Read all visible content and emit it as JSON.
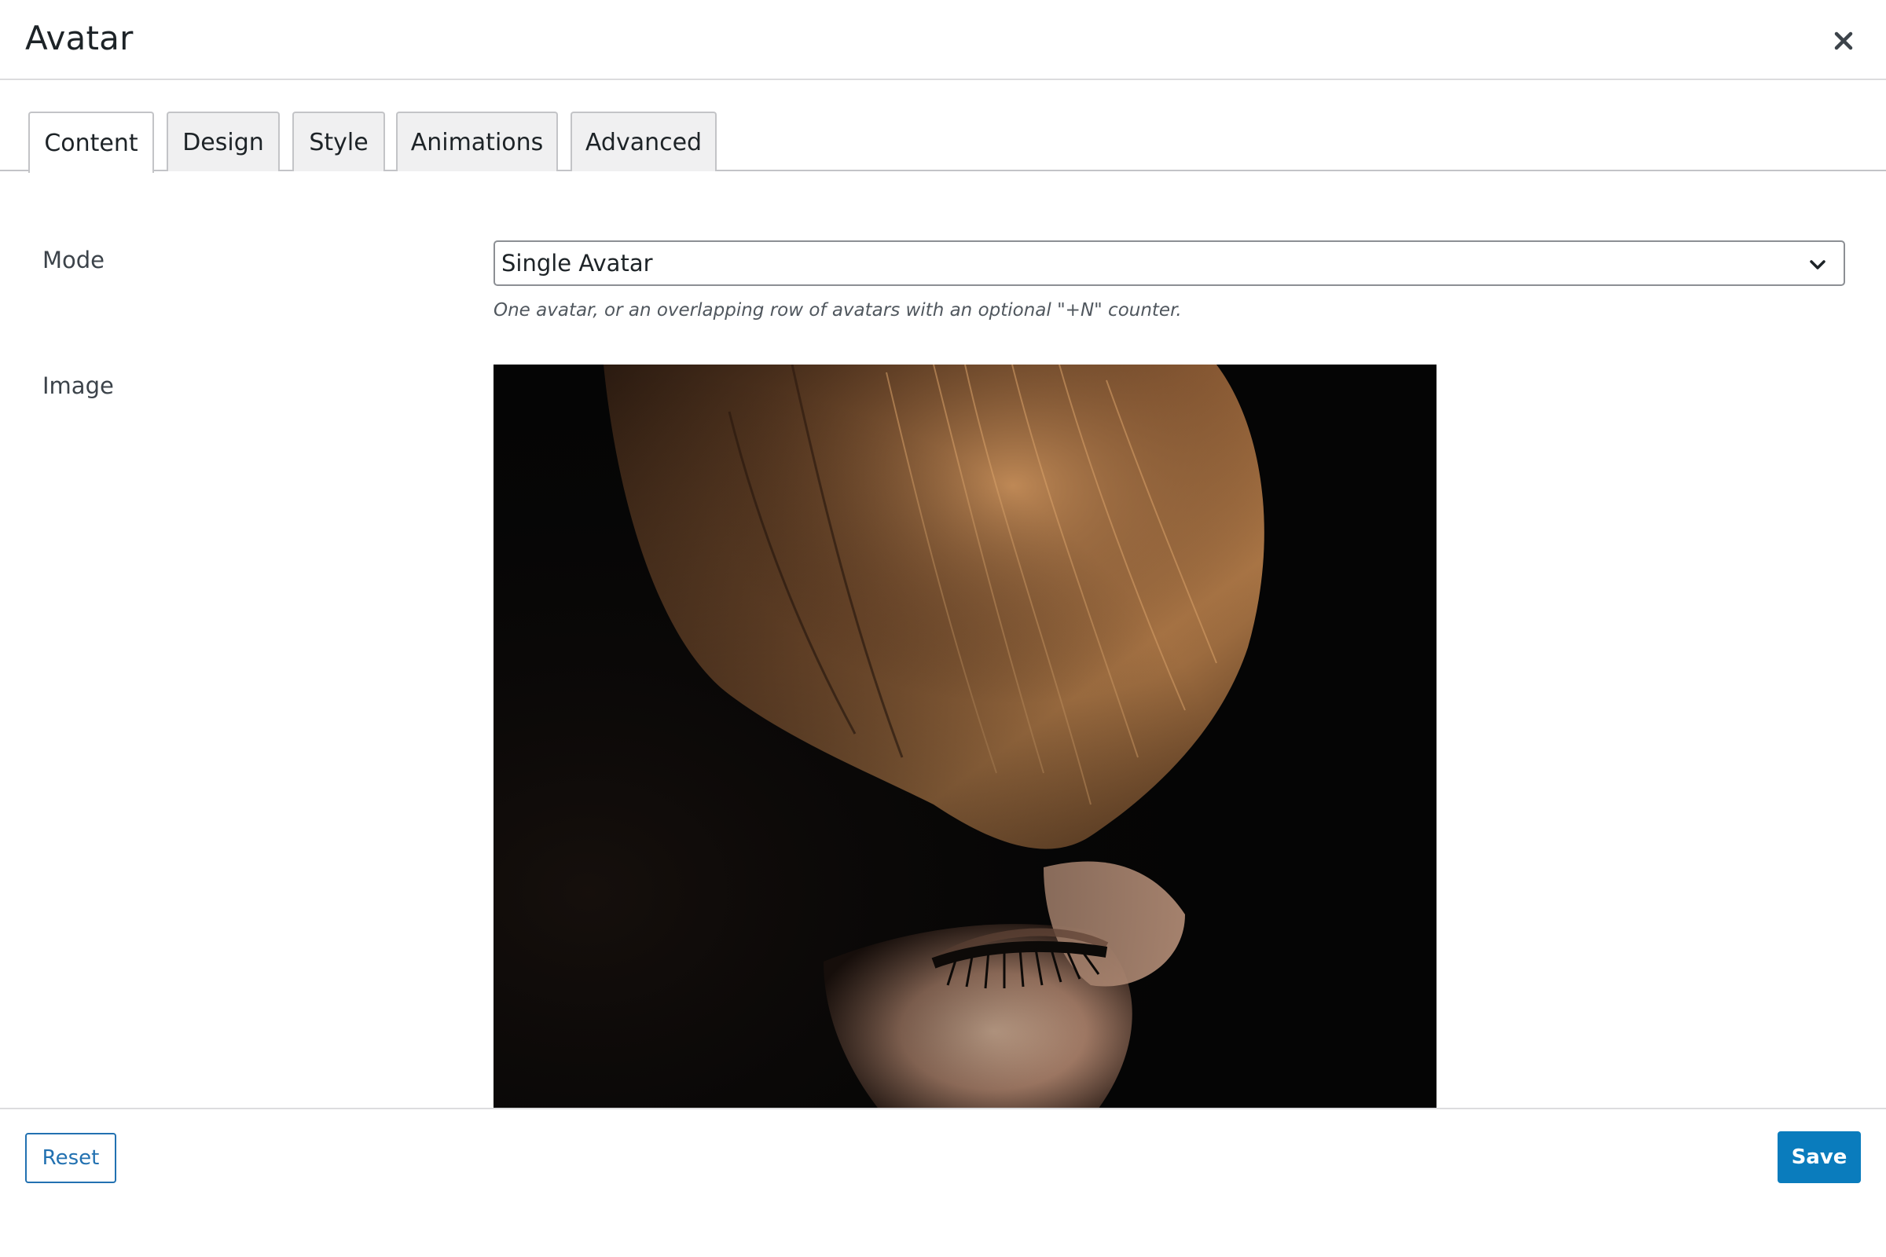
{
  "modal": {
    "title": "Avatar"
  },
  "tabs": [
    {
      "label": "Content",
      "active": true
    },
    {
      "label": "Design",
      "active": false
    },
    {
      "label": "Style",
      "active": false
    },
    {
      "label": "Animations",
      "active": false
    },
    {
      "label": "Advanced",
      "active": false
    }
  ],
  "fields": {
    "mode": {
      "label": "Mode",
      "value": "Single Avatar",
      "description": "One avatar, or an overlapping row of avatars with an optional \"+N\" counter."
    },
    "image": {
      "label": "Image"
    }
  },
  "footer": {
    "reset_label": "Reset",
    "save_label": "Save"
  },
  "colors": {
    "accent": "#2271b1",
    "save_button": "#0a7cbd",
    "image_background": "#050505"
  },
  "icons": {
    "close": "close-icon",
    "dropdown": "chevron-down-icon"
  }
}
